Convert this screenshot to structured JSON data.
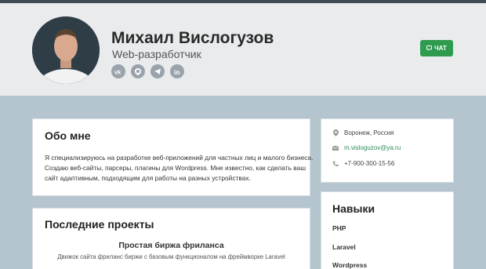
{
  "profile": {
    "name": "Михаил Вислогузов",
    "role": "Web-разработчик",
    "socials": [
      {
        "icon": "vk-icon"
      },
      {
        "icon": "github-icon"
      },
      {
        "icon": "telegram-icon"
      },
      {
        "icon": "linkedin-icon"
      }
    ]
  },
  "chat_button": {
    "label": "ЧАТ",
    "color": "#2e9b4f"
  },
  "about": {
    "title": "Обо мне",
    "lines": [
      "Я специализируюсь на разработке веб-приложений для частных лиц и малого бизнеса.",
      "Создаю веб-сайты, парсеры, плагины для Wordpress. Мне известно, как сделать ваш",
      "сайт адаптивным, подходящим для работы на разных устройствах."
    ]
  },
  "contacts": {
    "location": "Воронеж, Россия",
    "email": "m.visloguzov@ya.ru",
    "phone": "+7-900-300-15-56"
  },
  "projects": {
    "title": "Последние проекты",
    "items": [
      {
        "name": "Простая биржа фриланса",
        "description": "Движок сайта фриланс биржи с базовым функционалом на фреймворке Laravel"
      }
    ]
  },
  "skills": {
    "title": "Навыки",
    "items": [
      "PHP",
      "Laravel",
      "Wordpress"
    ]
  },
  "colors": {
    "accent": "#2e9b4f",
    "background": "#b5c5cf",
    "header": "#e9ebed"
  }
}
